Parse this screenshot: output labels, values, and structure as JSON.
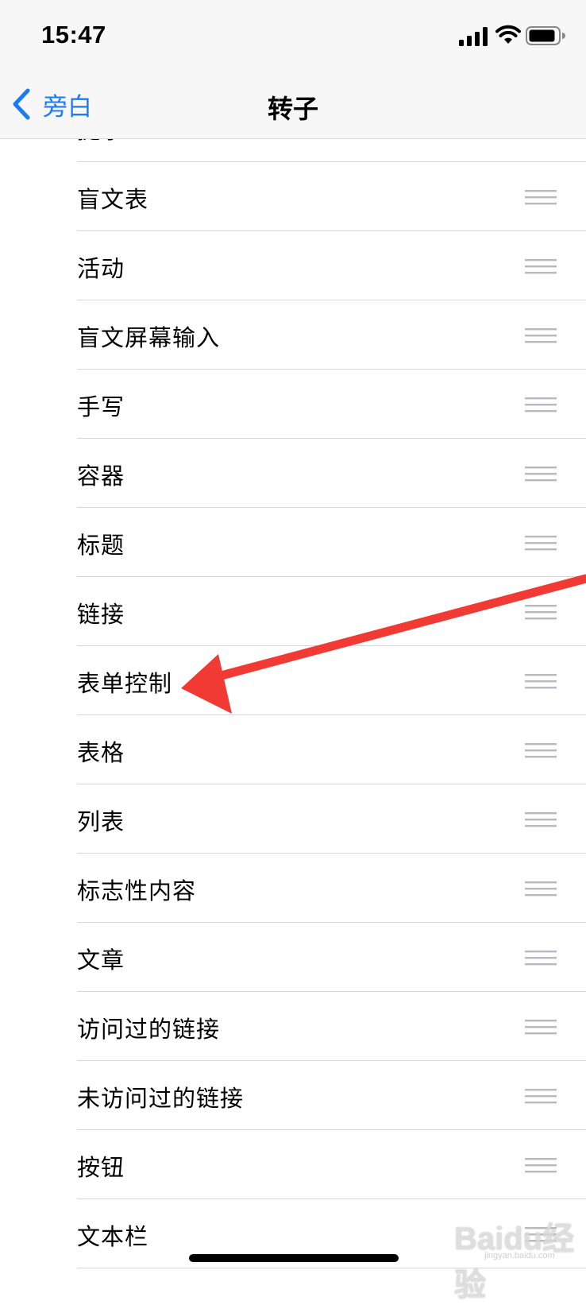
{
  "status_bar": {
    "time": "15:47",
    "icons": [
      "signal-icon",
      "wifi-icon",
      "battery-icon"
    ]
  },
  "nav": {
    "back_label": "旁白",
    "title": "转子"
  },
  "items": [
    "提示",
    "盲文表",
    "活动",
    "盲文屏幕输入",
    "手写",
    "容器",
    "标题",
    "链接",
    "表单控制",
    "表格",
    "列表",
    "标志性内容",
    "文章",
    "访问过的链接",
    "未访问过的链接",
    "按钮",
    "文本栏"
  ],
  "watermark": {
    "text": "Baidu经验",
    "sub": "jingyan.baidu.com"
  },
  "colors": {
    "accent": "#1a7cf5",
    "annotation_arrow": "#f23a35"
  }
}
